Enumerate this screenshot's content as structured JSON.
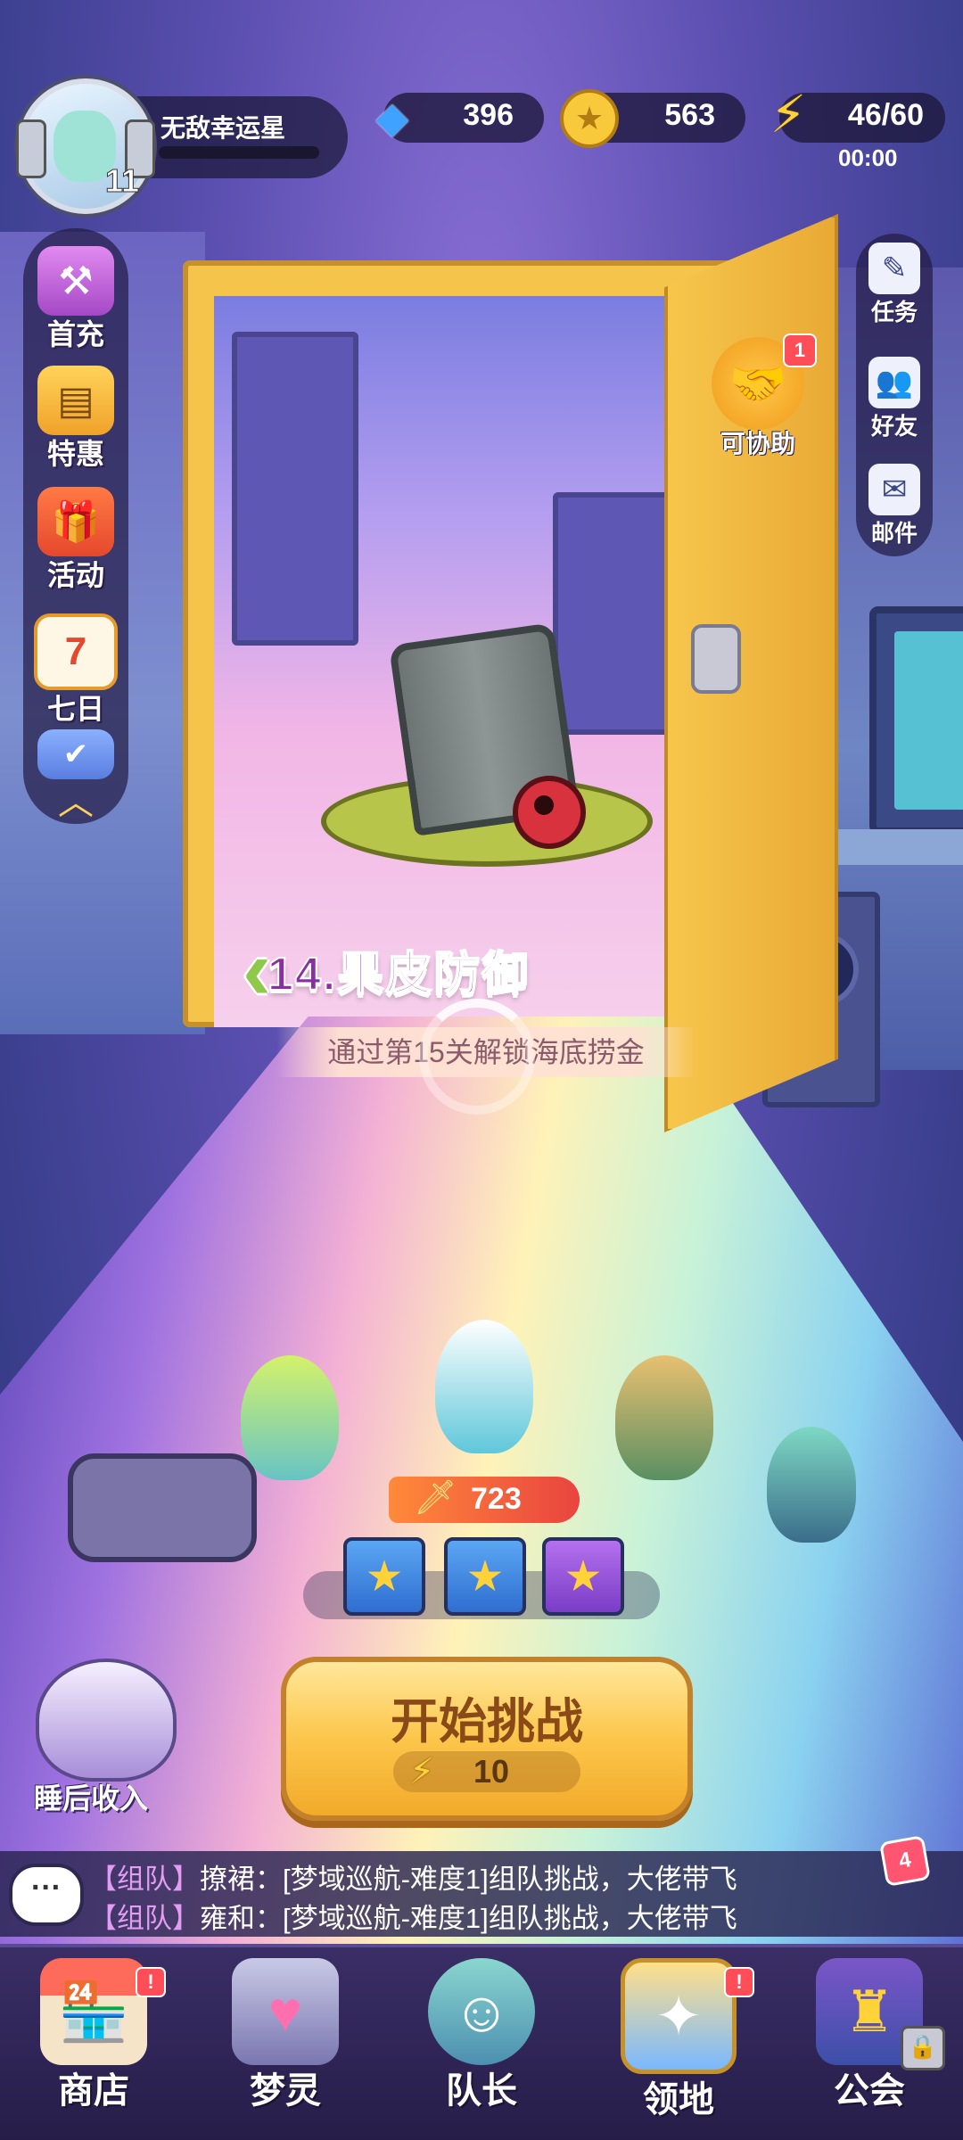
{
  "player": {
    "name": "无敌幸运星",
    "level": "11"
  },
  "resources": {
    "gems": "396",
    "coins": "563",
    "energy": "46/60",
    "energy_timer": "00:00"
  },
  "left_menu": [
    {
      "label": "首充",
      "icon": "hammer-icon"
    },
    {
      "label": "特惠",
      "icon": "tickets-icon"
    },
    {
      "label": "活动",
      "icon": "gift-box-icon"
    },
    {
      "label": "七日",
      "icon": "calendar-icon"
    }
  ],
  "right_menu": [
    {
      "label": "任务",
      "icon": "clipboard-icon"
    },
    {
      "label": "好友",
      "icon": "friends-icon"
    },
    {
      "label": "邮件",
      "icon": "mail-icon"
    }
  ],
  "assist": {
    "label": "可协助",
    "badge": "1"
  },
  "stage": {
    "title": "14.果皮防御",
    "hint": "通过第15关解锁海底捞金"
  },
  "team": {
    "power": "723"
  },
  "start": {
    "label": "开始挑战",
    "cost": "10"
  },
  "sleep_income": {
    "label": "睡后收入"
  },
  "chat": {
    "badge": "4",
    "icon_text": "···",
    "lines": [
      {
        "tag": "【组队】",
        "text": "撩裙：[梦域巡航-难度1]组队挑战，大佬带飞"
      },
      {
        "tag": "【组队】",
        "text": "雍和：[梦域巡航-难度1]组队挑战，大佬带飞"
      }
    ]
  },
  "nav": [
    {
      "label": "商店",
      "icon": "shop-icon",
      "alert": "!"
    },
    {
      "label": "梦灵",
      "icon": "spirit-machine-icon",
      "alert": ""
    },
    {
      "label": "队长",
      "icon": "captain-avatar-icon",
      "alert": ""
    },
    {
      "label": "领地",
      "icon": "territory-portal-icon",
      "alert": "!"
    },
    {
      "label": "公会",
      "icon": "guild-hat-icon",
      "alert": ""
    }
  ],
  "colors": {
    "accent": "#fcc64b",
    "title": "#8a2fa0",
    "alert": "#ff4e58"
  }
}
